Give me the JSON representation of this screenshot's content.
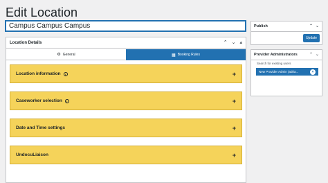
{
  "page": {
    "title": "Edit Location"
  },
  "title_field": {
    "value": "Campus Campus Campus"
  },
  "location_details": {
    "heading": "Location Details",
    "tabs": [
      {
        "label": "General",
        "icon": "gear-icon"
      },
      {
        "label": "Booking Rules",
        "icon": "calendar-icon"
      }
    ],
    "panels": [
      {
        "label": "Location information",
        "has_info": true
      },
      {
        "label": "Caseworker selection",
        "has_info": true
      },
      {
        "label": "Date and Time settings",
        "has_info": false
      },
      {
        "label": "UndocuLiaison",
        "has_info": false
      }
    ]
  },
  "publish": {
    "heading": "Publish",
    "update_label": "Update"
  },
  "provider_admins": {
    "heading": "Provider Administrators",
    "search_placeholder": "Search for existing users",
    "selected": "New Provider Admin (adria..."
  },
  "colors": {
    "accent": "#2271b1",
    "panel": "#f5d35a"
  }
}
